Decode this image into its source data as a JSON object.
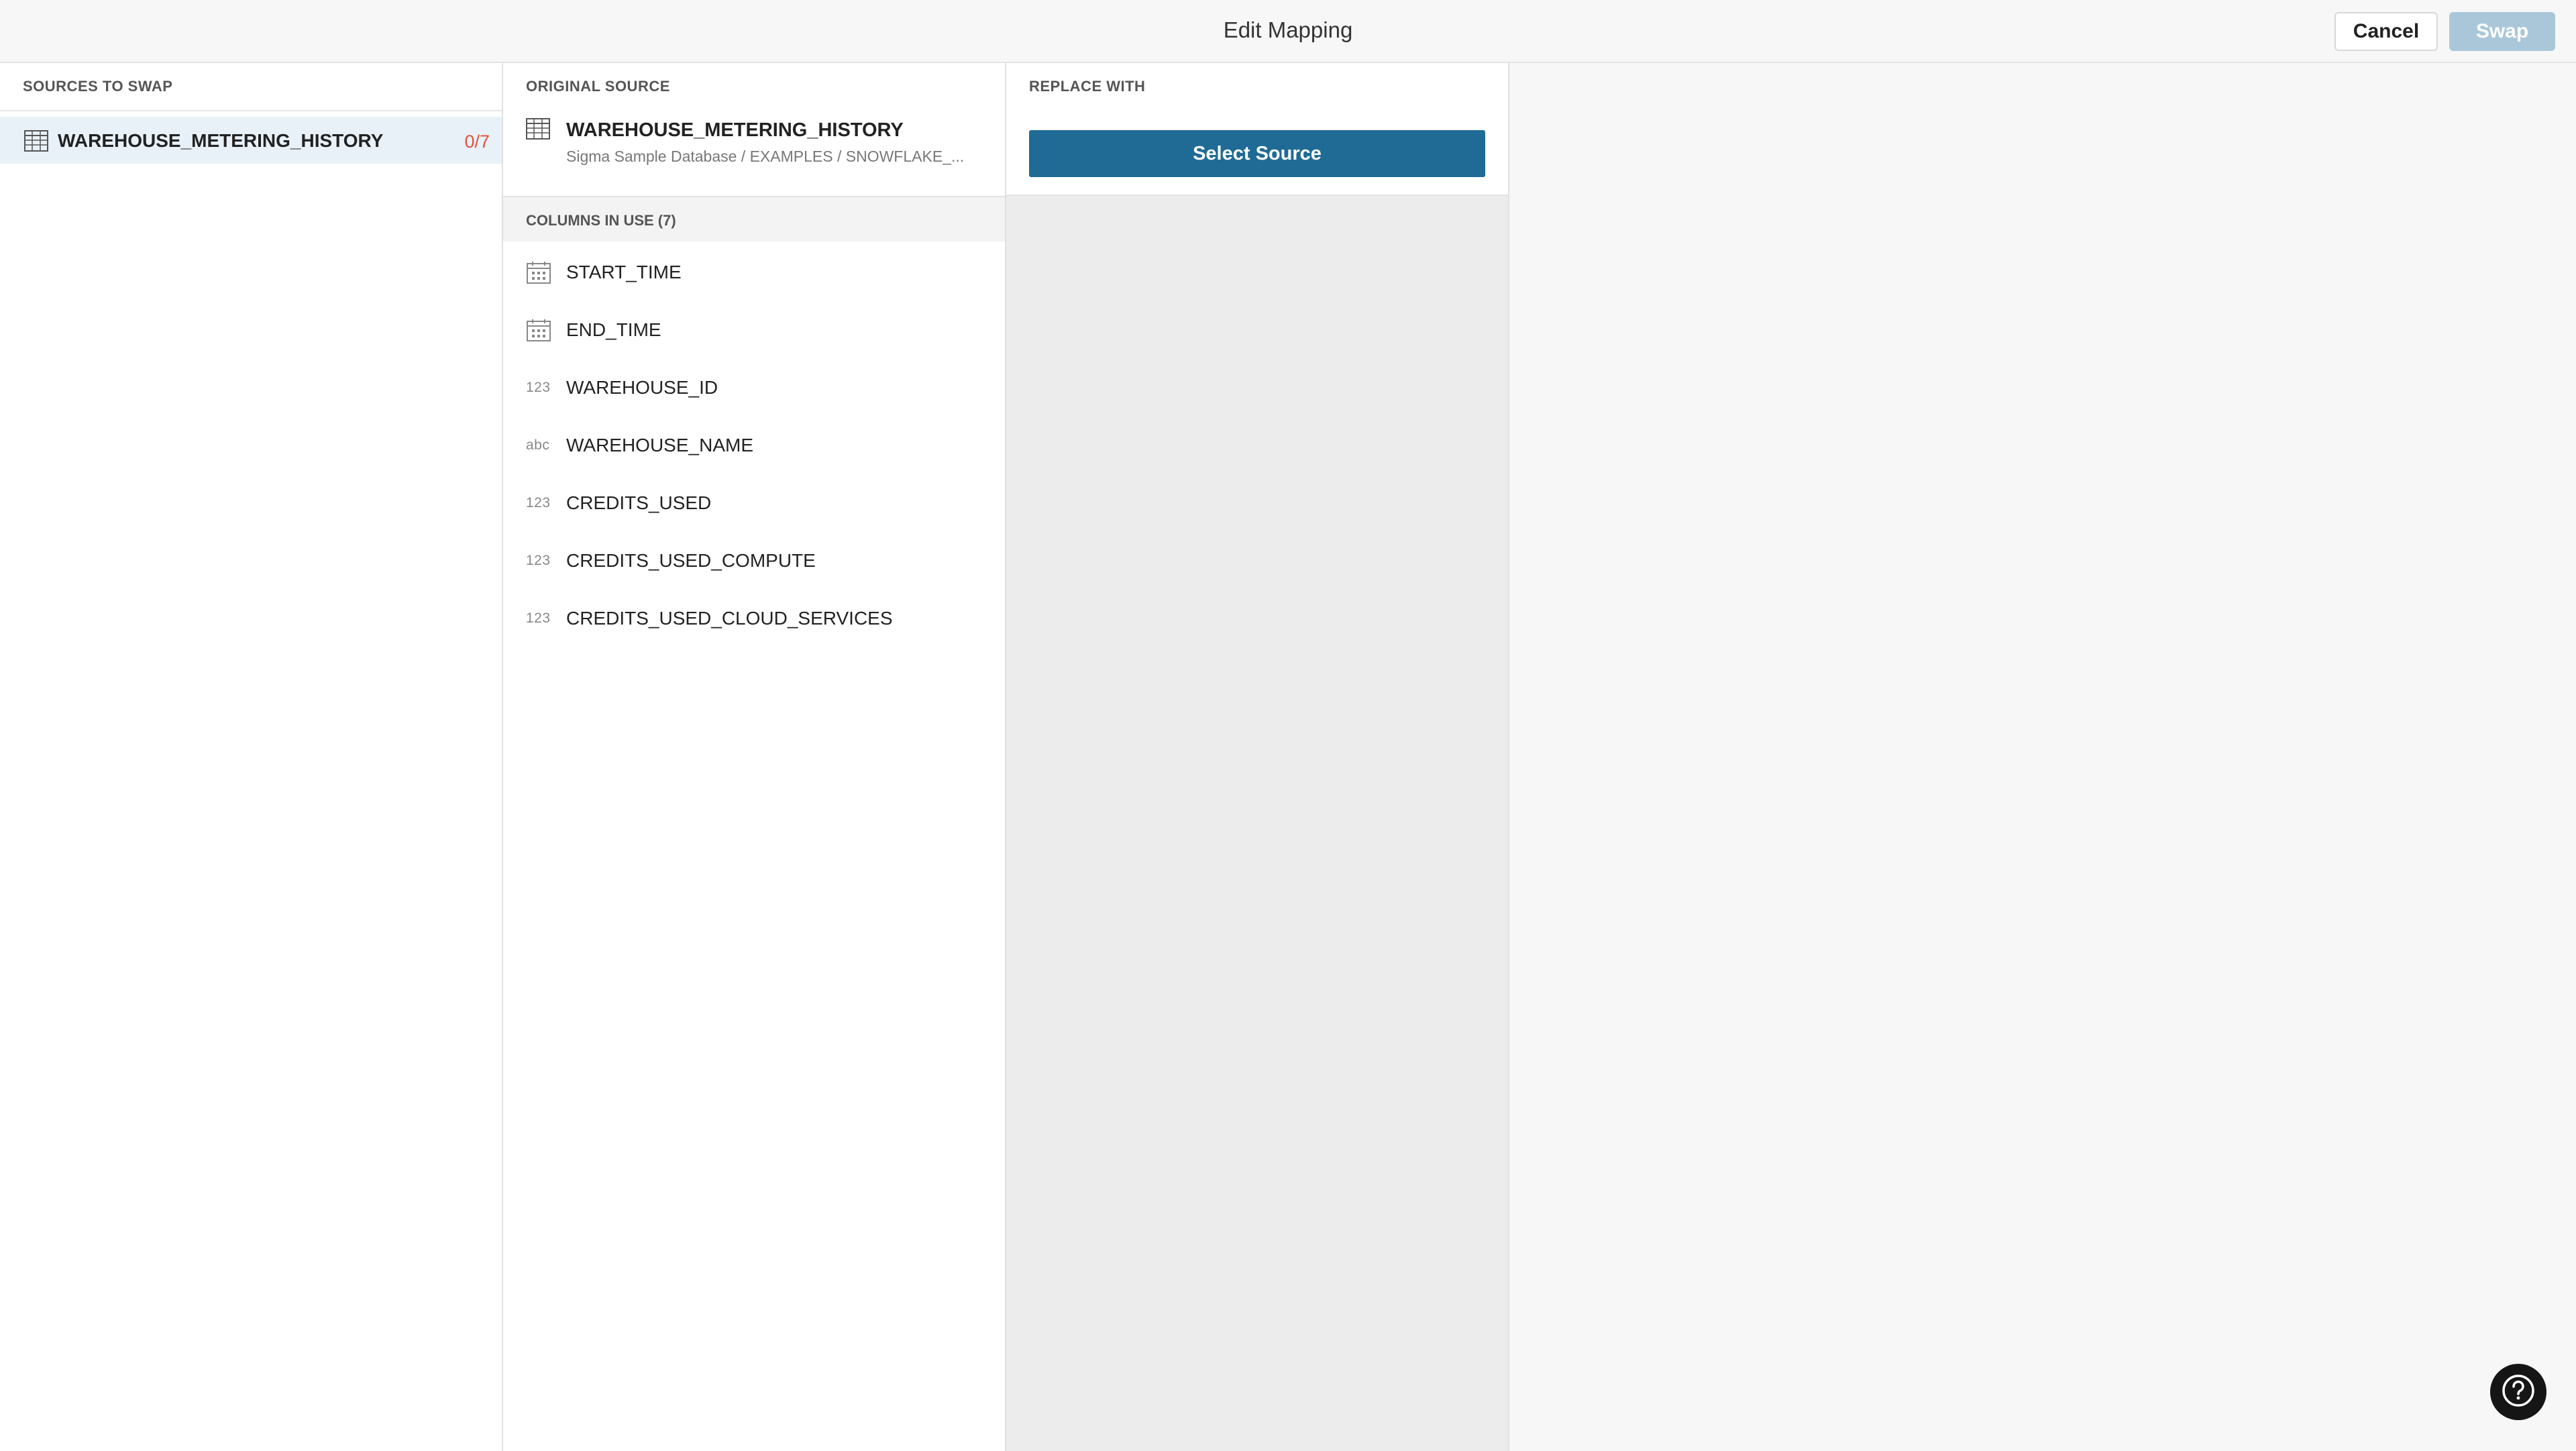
{
  "header": {
    "title": "Edit Mapping",
    "cancel_label": "Cancel",
    "swap_label": "Swap"
  },
  "sources_panel": {
    "label": "SOURCES TO SWAP",
    "items": [
      {
        "name": "WAREHOUSE_METERING_HISTORY",
        "count": "0/7",
        "icon": "table-icon"
      }
    ]
  },
  "original_panel": {
    "label": "ORIGINAL SOURCE",
    "source_name": "WAREHOUSE_METERING_HISTORY",
    "source_path": "Sigma Sample Database / EXAMPLES / SNOWFLAKE_...",
    "columns_header": "COLUMNS IN USE (7)",
    "columns": [
      {
        "type": "date",
        "type_label": "",
        "name": "START_TIME"
      },
      {
        "type": "date",
        "type_label": "",
        "name": "END_TIME"
      },
      {
        "type": "number",
        "type_label": "123",
        "name": "WAREHOUSE_ID"
      },
      {
        "type": "text",
        "type_label": "abc",
        "name": "WAREHOUSE_NAME"
      },
      {
        "type": "number",
        "type_label": "123",
        "name": "CREDITS_USED"
      },
      {
        "type": "number",
        "type_label": "123",
        "name": "CREDITS_USED_COMPUTE"
      },
      {
        "type": "number",
        "type_label": "123",
        "name": "CREDITS_USED_CLOUD_SERVICES"
      }
    ]
  },
  "replace_panel": {
    "label": "REPLACE WITH",
    "select_label": "Select Source"
  },
  "help": {
    "icon": "help-icon"
  },
  "colors": {
    "accent": "#1f6b96",
    "swap_disabled": "#a9c7d8",
    "count_red": "#e0533c",
    "selected_row": "#e9f1f8"
  }
}
